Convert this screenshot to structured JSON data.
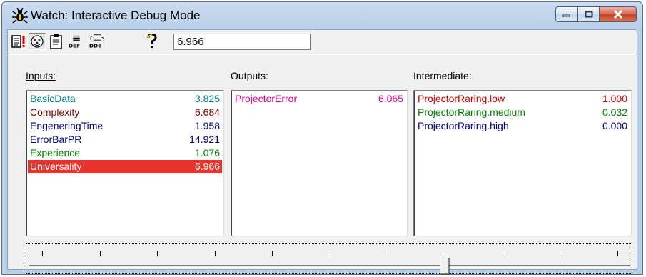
{
  "window": {
    "title": "Watch: Interactive Debug Mode",
    "icon": "bug-icon"
  },
  "toolbar": {
    "buttons": [
      {
        "name": "watch-list-icon",
        "pressed": false
      },
      {
        "name": "face-icon",
        "pressed": true
      },
      {
        "name": "clipboard-icon",
        "pressed": false
      },
      {
        "name": "def-icon",
        "label": "DEF",
        "pressed": false
      },
      {
        "name": "dde-icon",
        "label": "DDE",
        "pressed": false
      },
      {
        "name": "help-icon",
        "pressed": false
      }
    ],
    "value": "6.966"
  },
  "inputs": {
    "label": "Inputs:",
    "items": [
      {
        "name": "BasicData",
        "value": "3.825",
        "color": "#008080"
      },
      {
        "name": "Complexity",
        "value": "6.684",
        "color": "#800000"
      },
      {
        "name": "EngeneringTime",
        "value": "1.958",
        "color": "#000080"
      },
      {
        "name": "ErrorBarPR",
        "value": "14.921",
        "color": "#000080"
      },
      {
        "name": "Experience",
        "value": "1.076",
        "color": "#008000"
      },
      {
        "name": "Universality",
        "value": "6.966",
        "color": "#e8322e",
        "selected": true
      }
    ]
  },
  "outputs": {
    "label": "Outputs:",
    "items": [
      {
        "name": "ProjectorError",
        "value": "6.065",
        "color": "#e0008a"
      }
    ]
  },
  "intermediate": {
    "label": "Intermediate:",
    "items": [
      {
        "name": "ProjectorRaring.low",
        "value": "1.000",
        "color": "#cc0000"
      },
      {
        "name": "ProjectorRaring.medium",
        "value": "0.032",
        "color": "#008000"
      },
      {
        "name": "ProjectorRaring.high",
        "value": "0.000",
        "color": "#000080"
      }
    ]
  },
  "slider": {
    "ticks": 11,
    "position": 0.7
  }
}
